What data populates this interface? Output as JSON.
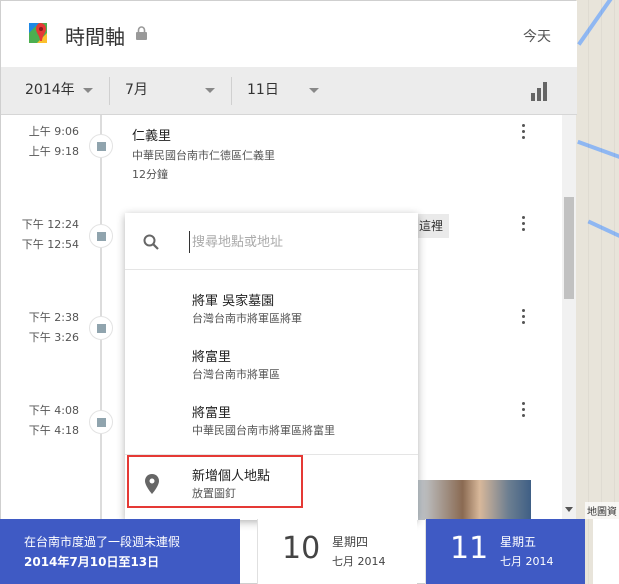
{
  "header": {
    "title": "時間軸",
    "today_label": "今天"
  },
  "date_bar": {
    "year": "2014年",
    "month": "7月",
    "day": "11日"
  },
  "timeline": [
    {
      "start": "上午 9:06",
      "end": "上午 9:18",
      "title": "仁義里",
      "address": "中華民國台南市仁德區仁義里",
      "duration": "12分鐘"
    },
    {
      "start": "下午 12:24",
      "end": "下午 12:54",
      "chip": "這裡"
    },
    {
      "start": "下午 2:38",
      "end": "下午 3:26"
    },
    {
      "start": "下午 4:08",
      "end": "下午 4:18"
    }
  ],
  "search": {
    "placeholder": "搜尋地點或地址",
    "suggestions": [
      {
        "title": "將軍 吳家墓園",
        "address": "台灣台南市將軍區將軍"
      },
      {
        "title": "將富里",
        "address": "台灣台南市將軍區"
      },
      {
        "title": "將富里",
        "address": "中華民國台南市將軍區將富里"
      }
    ],
    "add_place": {
      "title": "新增個人地點",
      "subtitle": "放置圖釘"
    }
  },
  "cards": {
    "trip": {
      "line1": "在台南市度過了一段週末連假",
      "line2": "2014年7月10日至13日"
    },
    "days": [
      {
        "num": "10",
        "weekday": "星期四",
        "month": "七月 2014",
        "active": false
      },
      {
        "num": "11",
        "weekday": "星期五",
        "month": "七月 2014",
        "active": true
      }
    ]
  },
  "map": {
    "credit": "地圖資"
  },
  "colors": {
    "accent": "#3f5ac4",
    "highlight": "#e53935"
  }
}
